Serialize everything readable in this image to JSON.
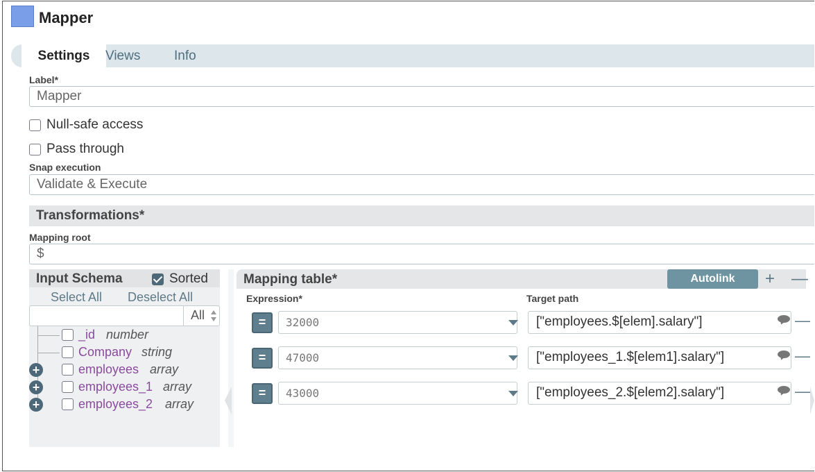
{
  "header": {
    "title": "Mapper"
  },
  "tabs": [
    {
      "label": "Settings"
    },
    {
      "label": "Views"
    },
    {
      "label": "Info"
    }
  ],
  "settings": {
    "label_field": {
      "label": "Label*",
      "value": "Mapper"
    },
    "null_safe": {
      "label": "Null-safe access",
      "checked": false
    },
    "pass_through": {
      "label": "Pass through",
      "checked": false
    },
    "snap_execution": {
      "label": "Snap execution",
      "value": "Validate & Execute"
    }
  },
  "transformations": {
    "title": "Transformations*",
    "mapping_root": {
      "label": "Mapping root",
      "value": "$"
    }
  },
  "input_schema": {
    "title": "Input Schema",
    "sorted_label": "Sorted",
    "sorted_checked": true,
    "select_all": "Select All",
    "deselect_all": "Deselect All",
    "filter_value": "All",
    "fields": [
      {
        "name": "_id",
        "type": "number",
        "expandable": false
      },
      {
        "name": "Company",
        "type": "string",
        "expandable": false
      },
      {
        "name": "employees",
        "type": "array",
        "expandable": true
      },
      {
        "name": "employees_1",
        "type": "array",
        "expandable": true
      },
      {
        "name": "employees_2",
        "type": "array",
        "expandable": true
      }
    ]
  },
  "mapping_table": {
    "title": "Mapping table*",
    "autolink_label": "Autolink",
    "add_symbol": "+",
    "remove_symbol": "—",
    "expression_label": "Expression*",
    "target_label": "Target path",
    "rows": [
      {
        "expression": "32000",
        "target": "[\"employees.$[elem].salary\"]"
      },
      {
        "expression": "47000",
        "target": "[\"employees_1.$[elem1].salary\"]"
      },
      {
        "expression": "43000",
        "target": "[\"employees_2.$[elem2].salary\"]"
      }
    ]
  },
  "colors": {
    "accent": "#6e94a2",
    "tab_bar": "#dde6ea",
    "field_name": "#8a4a9e",
    "icon": "#7b9ee8"
  },
  "icons": {
    "title": "snap-square-icon",
    "expand": "plus-circle-icon",
    "comment": "comment-bubble-icon",
    "dropdown": "chevron-down-icon",
    "expression_toggle": "equals-icon"
  }
}
